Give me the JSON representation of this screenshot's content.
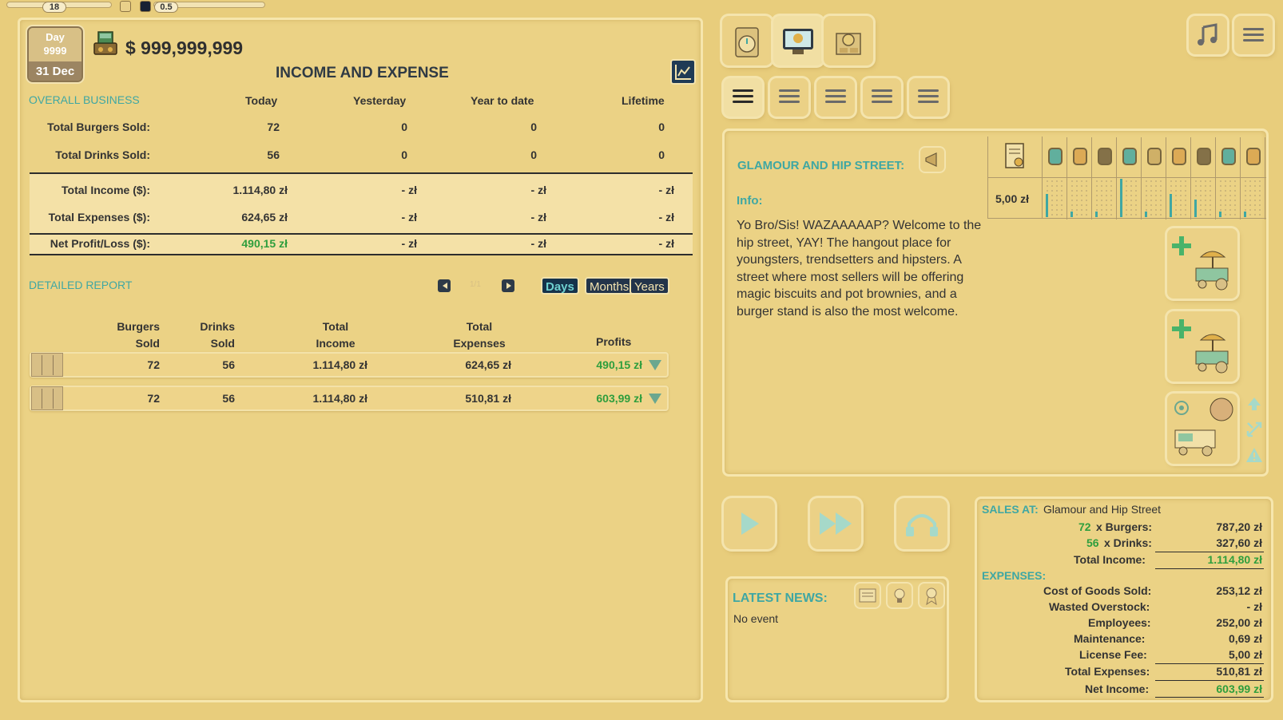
{
  "debug": {
    "slider1_value": "18",
    "slider2_value": "0.5"
  },
  "header": {
    "day_label": "Day",
    "day_number": "9999",
    "date": "31 Dec",
    "money": "$ 999,999,999",
    "title": "INCOME AND EXPENSE"
  },
  "overall": {
    "section_label": "OVERALL BUSINESS",
    "columns": [
      "Today",
      "Yesterday",
      "Year to date",
      "Lifetime"
    ],
    "rows": [
      {
        "label": "Total Burgers Sold:",
        "values": [
          "72",
          "0",
          "0",
          "0"
        ]
      },
      {
        "label": "Total Drinks Sold:",
        "values": [
          "56",
          "0",
          "0",
          "0"
        ]
      },
      {
        "label": "Total Income ($):",
        "values": [
          "1.114,80 zł",
          "- zł",
          "- zł",
          "- zł"
        ]
      },
      {
        "label": "Total Expenses ($):",
        "values": [
          "624,65 zł",
          "- zł",
          "- zł",
          "- zł"
        ]
      },
      {
        "label": "Net Profit/Loss ($):",
        "values": [
          "490,15 zł",
          "- zł",
          "- zł",
          "- zł"
        ]
      }
    ]
  },
  "detailed": {
    "section_label": "DETAILED REPORT",
    "page_indicator": "1/1",
    "toggles": {
      "days": "Days",
      "months": "Months",
      "years": "Years"
    },
    "headers": {
      "burgers_1": "Burgers",
      "burgers_2": "Sold",
      "drinks_1": "Drinks",
      "drinks_2": "Sold",
      "income_1": "Total",
      "income_2": "Income",
      "expenses_1": "Total",
      "expenses_2": "Expenses",
      "profits": "Profits"
    },
    "rows": [
      {
        "burgers": "72",
        "drinks": "56",
        "income": "1.114,80 zł",
        "expenses": "624,65 zł",
        "profit": "490,15 zł"
      },
      {
        "burgers": "72",
        "drinks": "56",
        "income": "1.114,80 zł",
        "expenses": "510,81 zł",
        "profit": "603,99 zł"
      }
    ]
  },
  "street": {
    "name": "GLAMOUR AND HIP STREET:",
    "info_label": "Info:",
    "info_text": "Yo Bro/Sis! WAZAAAAAP? Welcome to the hip street, YAY! The hangout place for youngsters, trendsetters and hipsters. A street where most sellers will be offering magic biscuits and pot brownies, and a burger stand is also the most welcome.",
    "license_price": "5,00 zł",
    "demographic_levels": [
      0.6,
      0.15,
      0.15,
      1.0,
      0.15,
      0.6,
      0.45,
      0.15,
      0.15
    ]
  },
  "news": {
    "label": "LATEST NEWS:",
    "text": "No event"
  },
  "sales": {
    "header_label": "SALES AT:",
    "location": "Glamour and Hip Street",
    "burgers_count": "72",
    "burgers_label": "x Burgers:",
    "burgers_value": "787,20 zł",
    "drinks_count": "56",
    "drinks_label": "x Drinks:",
    "drinks_value": "327,60 zł",
    "total_income_label": "Total Income:",
    "total_income_value": "1.114,80 zł",
    "expenses_label": "EXPENSES:",
    "cogs_label": "Cost of Goods Sold:",
    "cogs_value": "253,12 zł",
    "wasted_label": "Wasted Overstock:",
    "wasted_value": "- zł",
    "employees_label": "Employees:",
    "employees_value": "252,00 zł",
    "maintenance_label": "Maintenance:",
    "maintenance_value": "0,69 zł",
    "license_label": "License Fee:",
    "license_value": "5,00 zł",
    "total_expenses_label": "Total Expenses:",
    "total_expenses_value": "510,81 zł",
    "net_income_label": "Net Income:",
    "net_income_value": "603,99 zł"
  },
  "colors": {
    "background": "#e8cd7c",
    "teal": "#3fa7a3",
    "green": "#2e9e3d",
    "dark_button": "#23344a"
  }
}
